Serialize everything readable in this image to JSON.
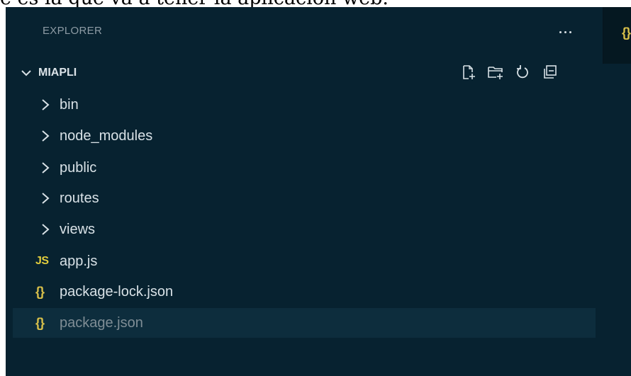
{
  "page": {
    "top_text": "e es la que va a tener la aplicación web."
  },
  "explorer": {
    "title": "EXPLORER",
    "more_actions_label": "...",
    "folder_name": "MIAPLI",
    "header_actions": [
      {
        "name": "new-file",
        "icon": "new-file-icon"
      },
      {
        "name": "new-folder",
        "icon": "new-folder-icon"
      },
      {
        "name": "refresh",
        "icon": "refresh-icon"
      },
      {
        "name": "collapse-all",
        "icon": "collapse-all-icon"
      }
    ],
    "folders": [
      {
        "label": "bin"
      },
      {
        "label": "node_modules"
      },
      {
        "label": "public"
      },
      {
        "label": "routes"
      },
      {
        "label": "views"
      }
    ],
    "files": [
      {
        "label": "app.js",
        "icon_text": "JS",
        "icon": "javascript-file-icon"
      },
      {
        "label": "package-lock.json",
        "icon_text": "{}",
        "icon": "json-file-icon"
      },
      {
        "label": "package.json",
        "icon_text": "{}",
        "icon": "json-file-icon",
        "selected": true
      }
    ]
  },
  "editor": {
    "tab_icon_text": "{}"
  },
  "colors": {
    "sidebar_background": "#072230",
    "selected_row": "#0d2d3d",
    "js_icon": "#e2cd3d",
    "json_icon": "#d9c04a",
    "text": "#d8e1e6"
  }
}
